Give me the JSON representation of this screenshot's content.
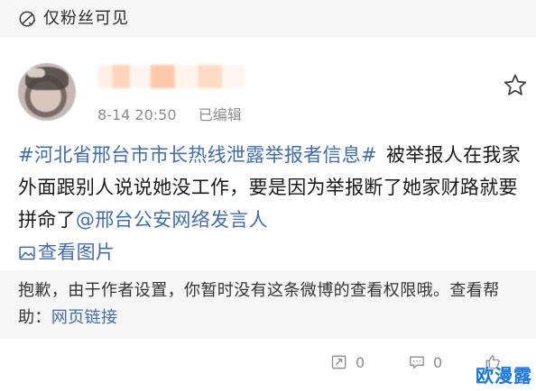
{
  "visibility": {
    "icon": "lock-icon",
    "text": "仅粉丝可见"
  },
  "post": {
    "author": {
      "avatar_icon": "blurred-avatar",
      "name_display": "blurred"
    },
    "meta": {
      "time": "8-14 20:50",
      "edited": "已编辑"
    },
    "content": {
      "hashtag": "#河北省邢台市市长热线泄露举报者信息#",
      "text_1": "被举报人在我家外面跟别人说说她没工作，要是因为举报断了她家财路就要拼命了",
      "mention": "@邢台公安网络发言人",
      "view_image_label": "查看图片",
      "view_image_icon": "image-icon"
    }
  },
  "notice": {
    "text": "抱歉，由于作者设置，你暂时没有这条微博的查看权限哦。查看帮助：",
    "link": "网页链接"
  },
  "actions": {
    "repost": {
      "icon": "repost-icon",
      "count": "0"
    },
    "comment": {
      "icon": "comment-icon",
      "count": "0"
    },
    "like": {
      "icon": "like-icon",
      "count": ""
    }
  },
  "watermark": "欧漫露",
  "colors": {
    "link": "#436da7",
    "muted": "#8c8c8c",
    "panel_bg": "#f6f6f6",
    "watermark": "#1677d9"
  }
}
